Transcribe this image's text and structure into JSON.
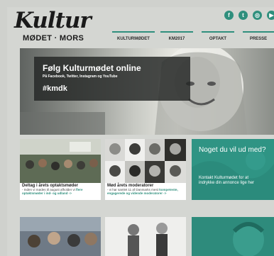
{
  "brand": {
    "script": "Kultur",
    "sub": "MØDET · MORS"
  },
  "social": [
    {
      "icon": "facebook-icon",
      "glyph": "f"
    },
    {
      "icon": "twitter-icon",
      "glyph": "t"
    },
    {
      "icon": "instagram-icon",
      "glyph": "◎"
    },
    {
      "icon": "youtube-icon",
      "glyph": "▶"
    }
  ],
  "nav": [
    "KULTURMØDET",
    "KM2017",
    "OPTAKT",
    "PRESSE"
  ],
  "hero": {
    "title": "Følg Kulturmødet online",
    "subtitle": "På Facebook, Twitter, Instagram og YouTube",
    "hashtag": "#kmdk",
    "slides": 10,
    "active_slide": 10
  },
  "cards": [
    {
      "title": "Deltag i årets optaktsmøder",
      "desc_pre": "- Inden vi mødes til august afholder vi ",
      "desc_link": "flere optaktsmøder i ind- og udland ->"
    },
    {
      "title": "Mød årets moderatorer",
      "desc_pre": "- vi har samlet 11 af Danmarks mest ",
      "desc_link": "kompetente, engagerede og vidende moderatorer ->"
    }
  ],
  "promo": {
    "title": "Noget du vil ud med?",
    "line1": "Kontakt Kulturmødet for at",
    "line2": "indrykke din annonce lige her"
  },
  "colors": {
    "accent": "#2f8f7d",
    "background": "#d4d6d2"
  }
}
